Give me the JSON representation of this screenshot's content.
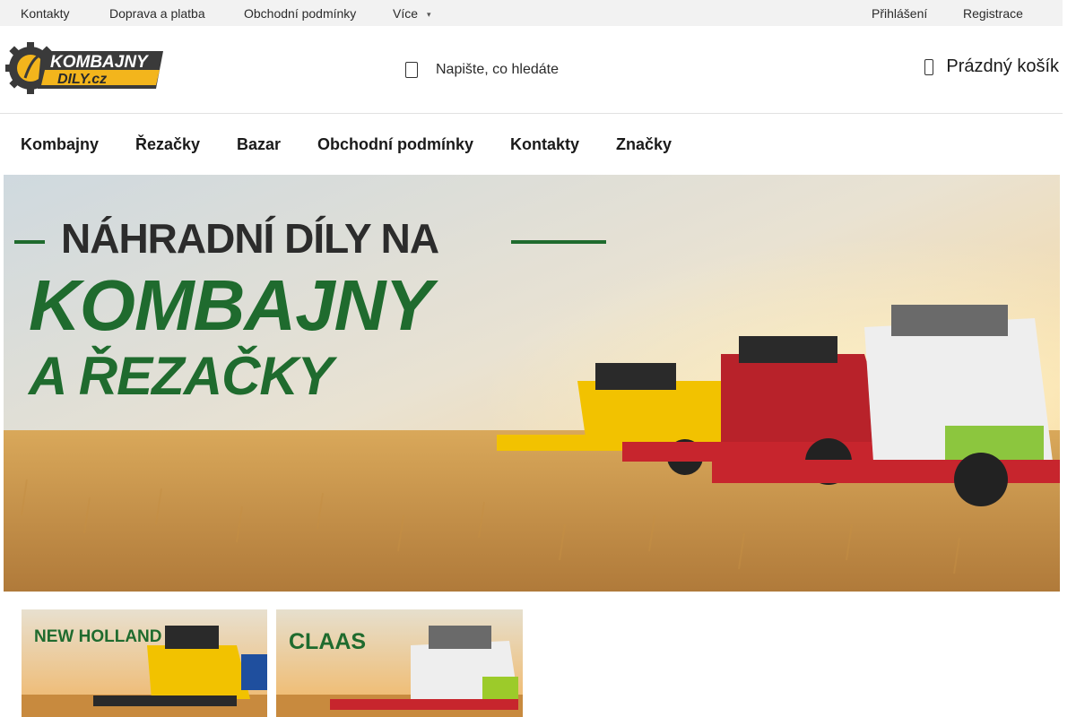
{
  "topbar": {
    "links": [
      "Kontakty",
      "Doprava a platba",
      "Obchodní podmínky",
      "Více"
    ],
    "login": "Přihlášení",
    "register": "Registrace"
  },
  "header": {
    "logo_text_line1": "KOMBAJNY",
    "logo_text_line2": "DILY.cz",
    "search_placeholder": "Napište, co hledáte",
    "cart_label": "Prázdný košík"
  },
  "nav": {
    "items": [
      "Kombajny",
      "Řezačky",
      "Bazar",
      "Obchodní podmínky",
      "Kontakty",
      "Značky"
    ]
  },
  "hero": {
    "line1": "NÁHRADNÍ DÍLY NA",
    "line2": "KOMBAJNY",
    "line3": "A ŘEZAČKY"
  },
  "tiles": [
    {
      "label": "NEW HOLLAND",
      "accent": "#f2c200"
    },
    {
      "label": "CLAAS",
      "accent": "#9ccb2a"
    }
  ],
  "colors": {
    "brand_green": "#1f6b2e",
    "topbar_bg": "#f2f2f2",
    "wheat": "#d9a85a"
  },
  "icons": [
    "search-icon",
    "cart-icon",
    "chevron-down-icon"
  ]
}
